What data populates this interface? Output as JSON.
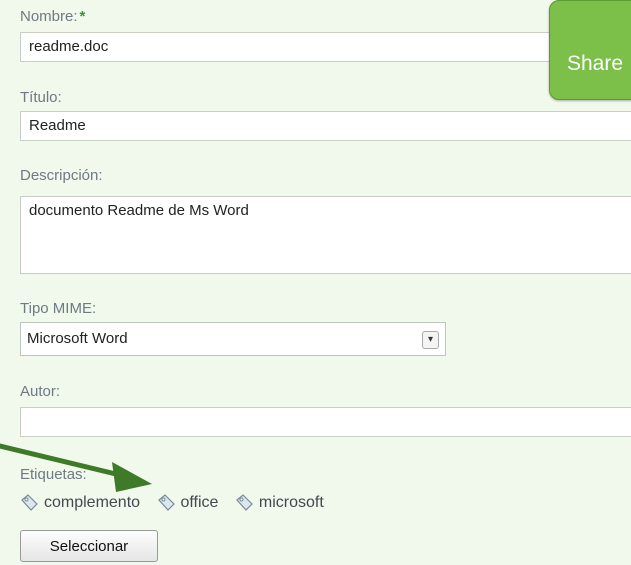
{
  "form": {
    "nombre": {
      "label": "Nombre:",
      "required_mark": "*",
      "value": "readme.doc"
    },
    "titulo": {
      "label": "Título:",
      "value": "Readme"
    },
    "descripcion": {
      "label": "Descripción:",
      "value": "documento Readme de Ms Word"
    },
    "tipo_mime": {
      "label": "Tipo MIME:",
      "value": "Microsoft Word"
    },
    "autor": {
      "label": "Autor:",
      "value": ""
    },
    "etiquetas": {
      "label": "Etiquetas:",
      "tags": [
        "complemento",
        "office",
        "microsoft"
      ],
      "button_label": "Seleccionar"
    }
  },
  "share": {
    "label": "Share"
  },
  "colors": {
    "accent": "#7cc04a",
    "arrow": "#3e7a28",
    "background": "#f1f8ec"
  }
}
